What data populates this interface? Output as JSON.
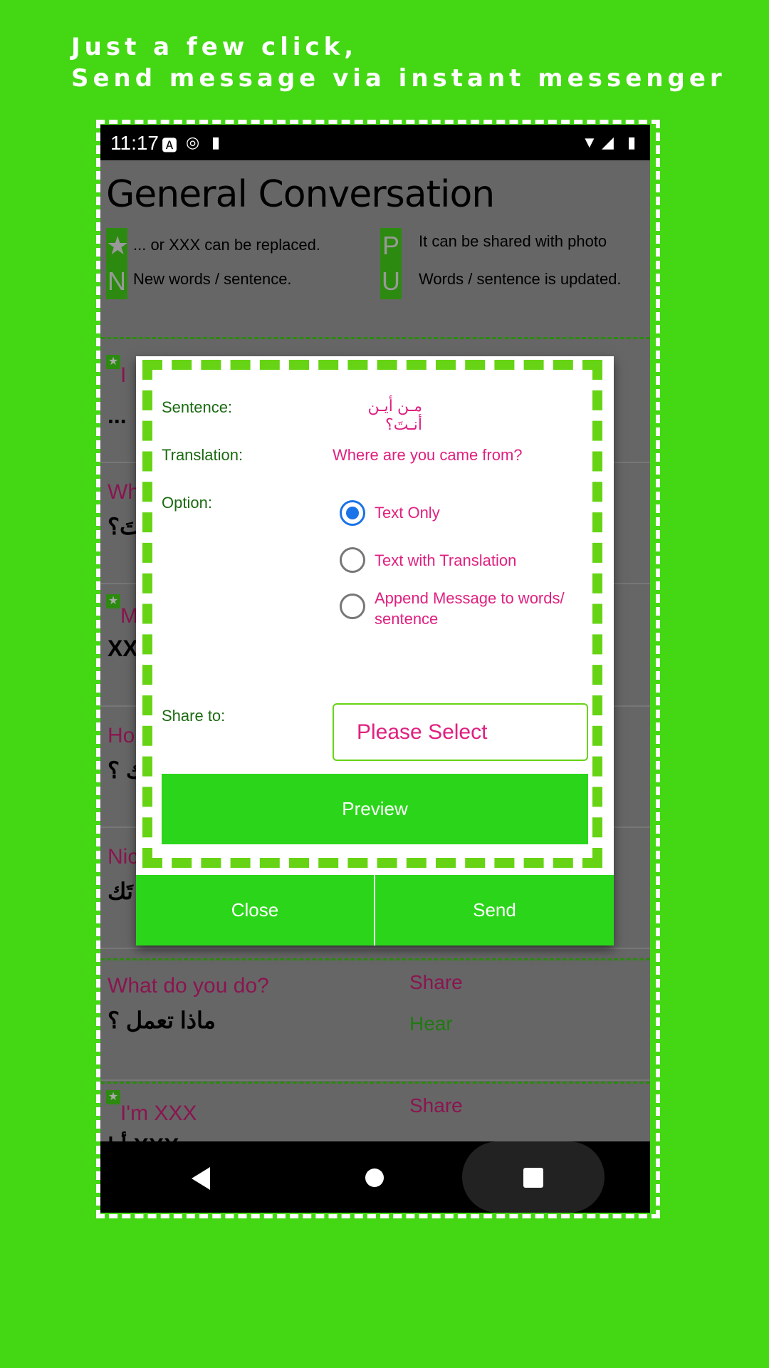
{
  "headline": {
    "line1": "Just a few click,",
    "line2": "Send message via instant messenger"
  },
  "status_bar": {
    "time": "11:17"
  },
  "app": {
    "title": "General Conversation",
    "legend": [
      {
        "badge": "★",
        "text": "... or XXX can be replaced."
      },
      {
        "badge": "N",
        "text": "New words / sentence."
      },
      {
        "badge": "P",
        "text": "It can be shared with photo"
      },
      {
        "badge": "U",
        "text": "Words / sentence is updated."
      }
    ],
    "items": [
      {
        "en": "I",
        "ar": "...",
        "star": true
      },
      {
        "en": "Wh",
        "ar": "تَ؟",
        "star": false
      },
      {
        "en": "M",
        "ar": "XX",
        "star": true
      },
      {
        "en": "Ho",
        "ar": "ك ؟",
        "star": false
      },
      {
        "en": "Nic",
        "ar": "تَك",
        "star": false
      },
      {
        "en": "What do you do?",
        "ar": "ماذا تعمل ؟",
        "share": "Share",
        "hear": "Hear",
        "star": false
      },
      {
        "en": "I'm XXX",
        "ar": "أنا XXX",
        "share": "Share",
        "star": true
      }
    ]
  },
  "dialog": {
    "sentence_label": "Sentence:",
    "sentence": "مـن أيـن أنـتَ؟",
    "translation_label": "Translation:",
    "translation": "Where are you came from?",
    "option_label": "Option:",
    "options": [
      {
        "label": "Text Only",
        "selected": true
      },
      {
        "label": "Text with Translation",
        "selected": false
      },
      {
        "label": "Append Message to words/ sentence",
        "selected": false
      }
    ],
    "share_label": "Share to:",
    "share_select": "Please Select",
    "preview": "Preview",
    "close": "Close",
    "send": "Send"
  },
  "colors": {
    "background": "#44d814",
    "button": "#2bd61a",
    "accent_text": "#e02080",
    "label": "#1a6a10",
    "radio": "#1a73e8"
  }
}
